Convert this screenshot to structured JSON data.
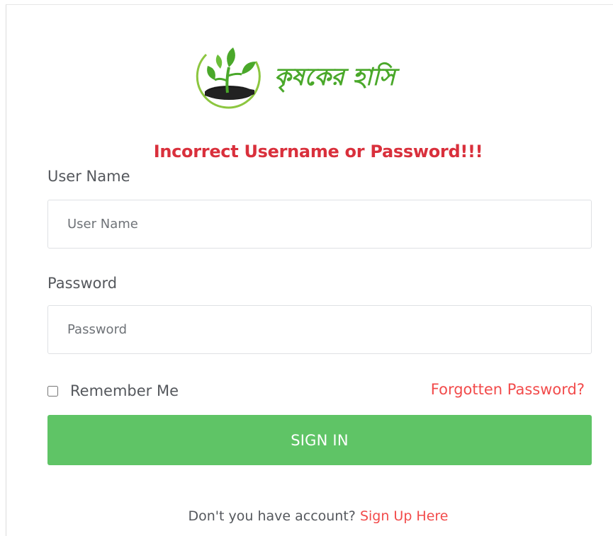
{
  "brand": {
    "name": "কৃষকের হাসি",
    "colors": {
      "leaf": "#4aa82a",
      "soil": "#1a1a1a",
      "ring": "#8cc63f"
    }
  },
  "error_message": "Incorrect Username or Password!!!",
  "form": {
    "username": {
      "label": "User Name",
      "placeholder": "User Name",
      "value": ""
    },
    "password": {
      "label": "Password",
      "placeholder": "Password",
      "value": ""
    },
    "remember_me": {
      "label": "Remember Me",
      "checked": false
    },
    "forgot_link": "Forgotten Password?",
    "submit_label": "SIGN IN"
  },
  "footer": {
    "prompt": "Don't you have account?",
    "signup_link": "Sign Up Here"
  },
  "colors": {
    "error": "#d9303c",
    "link": "#f24b4b",
    "button": "#5fc466",
    "text": "#55585d"
  }
}
